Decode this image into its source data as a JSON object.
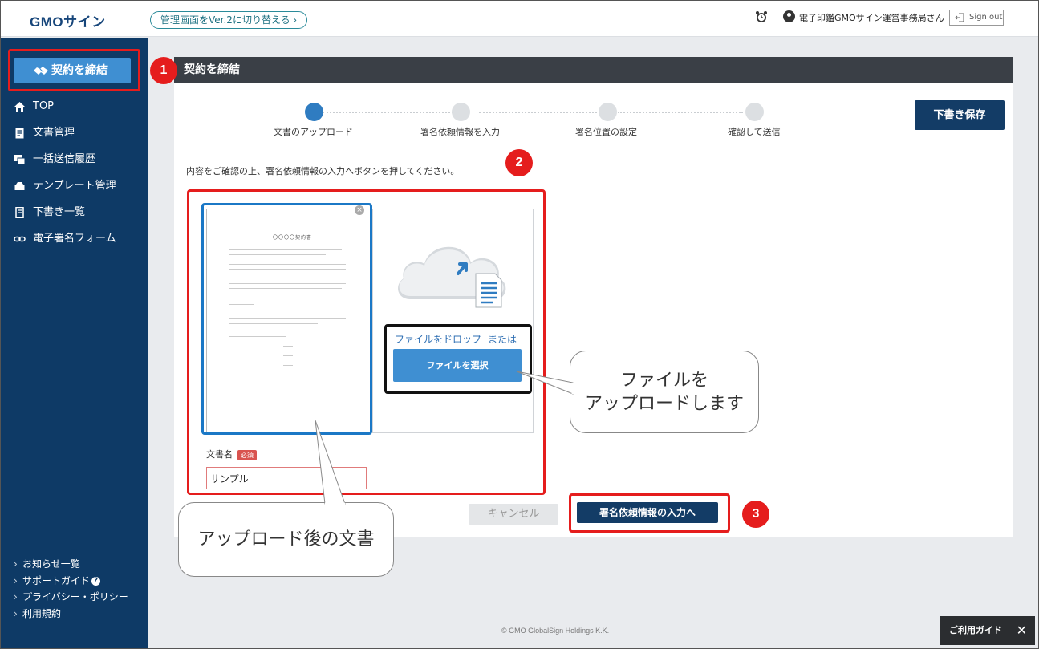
{
  "header": {
    "logo": "GMOサイン",
    "switch_link": "管理画面をVer.2に切り替える ›",
    "user_name": "電子印鑑GMOサイン運営事務局さん",
    "signout": "Sign out"
  },
  "sidebar": {
    "contract_button": "契約を締結",
    "items": [
      {
        "label": "TOP",
        "icon": "home-icon"
      },
      {
        "label": "文書管理",
        "icon": "document-icon"
      },
      {
        "label": "一括送信履歴",
        "icon": "bulk-send-icon"
      },
      {
        "label": "テンプレート管理",
        "icon": "template-icon"
      },
      {
        "label": "下書き一覧",
        "icon": "draft-icon"
      },
      {
        "label": "電子署名フォーム",
        "icon": "link-icon"
      }
    ],
    "footer": [
      "お知らせ一覧",
      "サポートガイド",
      "プライバシー・ポリシー",
      "利用規約"
    ]
  },
  "panel": {
    "title": "契約を締結",
    "steps": [
      "文書のアップロード",
      "署名依頼情報を入力",
      "署名位置の設定",
      "確認して送信"
    ],
    "active_step": 1,
    "draft_button": "下書き保存",
    "instruction": "内容をご確認の上、署名依頼情報の入力へボタンを押してください。",
    "doc_preview_title": "〇〇〇〇契約書",
    "drop_text": "ファイルをドロップ",
    "drop_or": "または",
    "select_button": "ファイルを選択",
    "docname_label": "文書名",
    "required_badge": "必須",
    "docname_value": "サンプル",
    "cancel_button": "キャンセル",
    "next_button": "署名依頼情報の入力へ"
  },
  "annotations": {
    "badges": [
      "1",
      "2",
      "3"
    ],
    "callout_upload_line1": "ファイルを",
    "callout_upload_line2": "アップロードします",
    "callout_document": "アップロード後の文書"
  },
  "footer": {
    "copyright": "© GMO GlobalSign Holdings K.K.",
    "guide": "ご利用ガイド"
  },
  "colors": {
    "sidebar": "#0e3a66",
    "primary_button": "#3f8fd2",
    "dark_button": "#133c66",
    "annotation_red": "#e51d1d",
    "annotation_blue": "#1b78c6"
  }
}
